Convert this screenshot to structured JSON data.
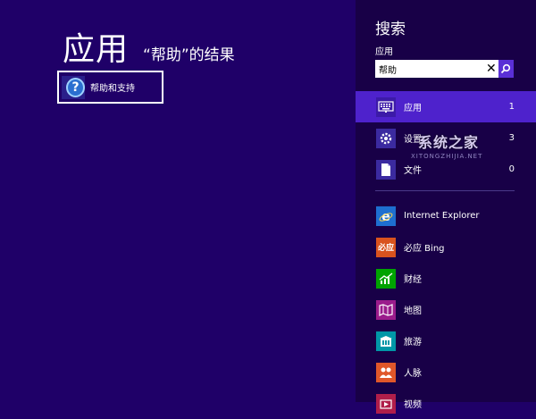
{
  "results": {
    "heading": "应用",
    "subheading": "“帮助”的结果",
    "items": [
      {
        "label": "帮助和支持",
        "icon": "help-icon"
      }
    ]
  },
  "search_pane": {
    "title": "搜索",
    "scope_label": "应用",
    "query": "帮助",
    "scopes": [
      {
        "name": "应用",
        "count": "1",
        "icon": "keyboard-icon",
        "selected": true
      },
      {
        "name": "设置",
        "count": "3",
        "icon": "settings-gear-icon",
        "selected": false
      },
      {
        "name": "文件",
        "count": "0",
        "icon": "file-icon",
        "selected": false
      }
    ],
    "apps": [
      {
        "name": "Internet Explorer",
        "icon": "internet-explorer-icon",
        "color": "#1e6fd0"
      },
      {
        "name": "必应 Bing",
        "icon": "bing-icon",
        "color": "#d9531e"
      },
      {
        "name": "财经",
        "icon": "finance-icon",
        "color": "#00a300"
      },
      {
        "name": "地图",
        "icon": "maps-icon",
        "color": "#9b1c8c"
      },
      {
        "name": "旅游",
        "icon": "travel-icon",
        "color": "#0097a7"
      },
      {
        "name": "人脉",
        "icon": "people-icon",
        "color": "#e0572a"
      },
      {
        "name": "视频",
        "icon": "video-icon",
        "color": "#b01e4a"
      }
    ]
  },
  "watermark": {
    "text": "系统之家",
    "sub": "XITONGZHIJIA.NET"
  },
  "colors": {
    "background": "#1f0068",
    "pane": "#180047",
    "selected_scope": "#4e22cc",
    "accent": "#5a2fd6"
  }
}
